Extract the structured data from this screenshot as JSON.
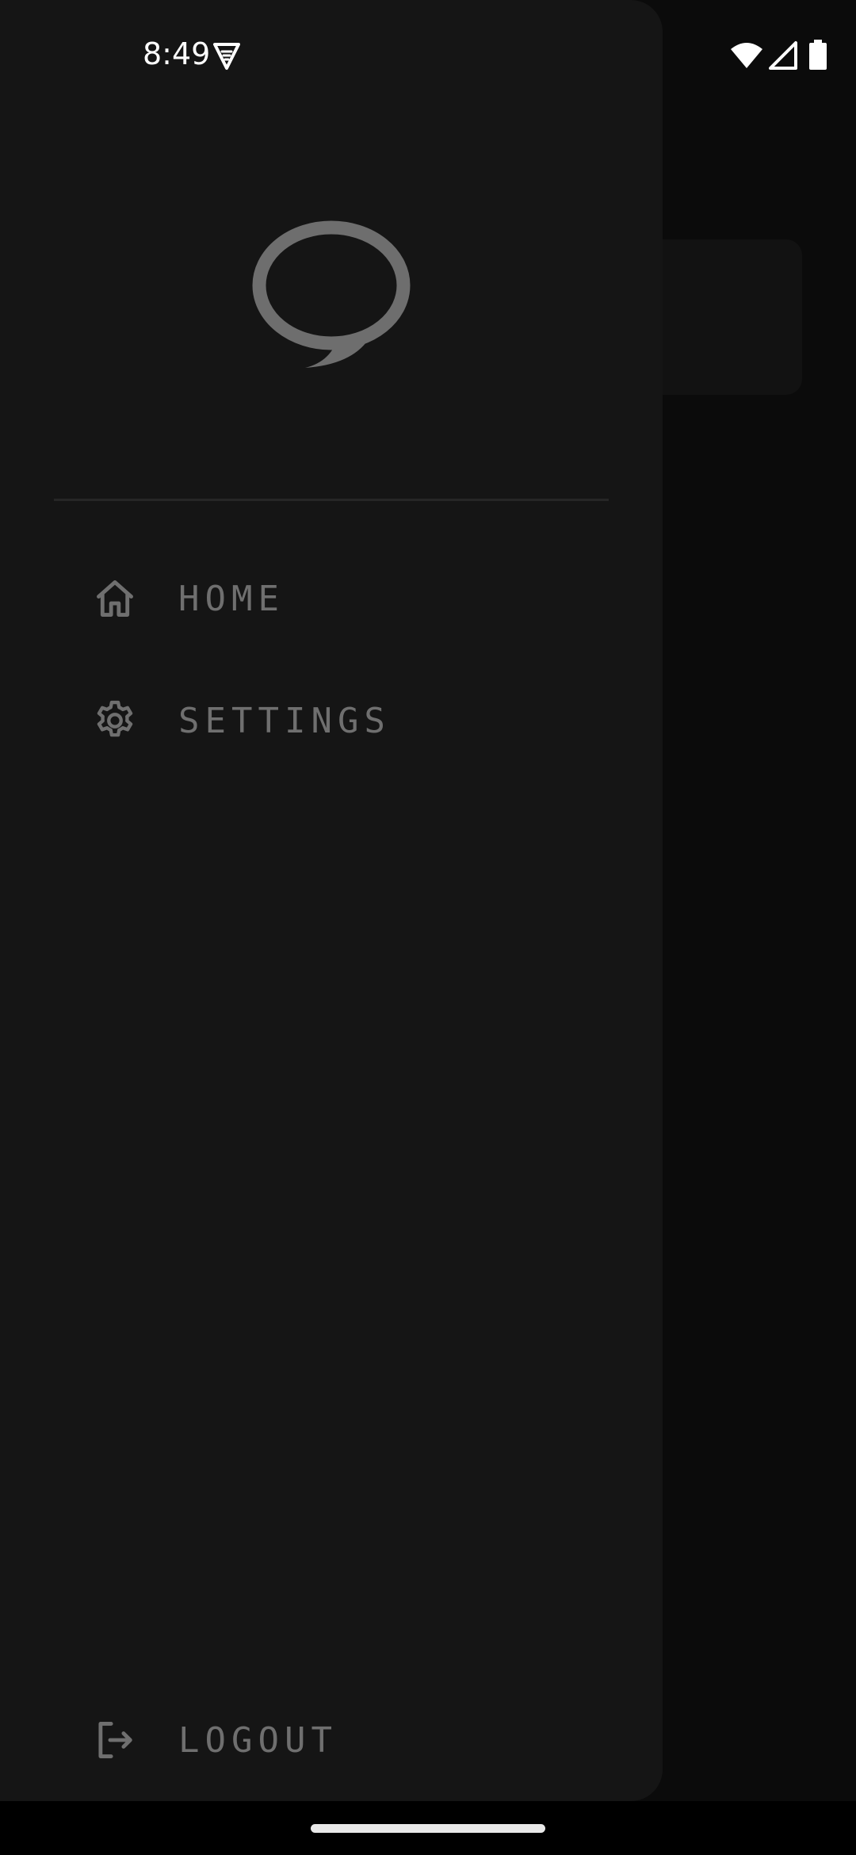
{
  "status_bar": {
    "time": "8:49",
    "vpn_icon": "vpn-key-icon",
    "wifi_icon": "wifi-icon",
    "signal_icon": "cell-signal-icon",
    "battery_icon": "battery-icon"
  },
  "drawer": {
    "logo_icon": "speech-bubble-logo-icon",
    "nav_items": [
      {
        "label": "HOME",
        "icon": "home-icon"
      },
      {
        "label": "SETTINGS",
        "icon": "gear-icon"
      }
    ],
    "logout": {
      "label": "LOGOUT",
      "icon": "logout-icon"
    }
  },
  "colors": {
    "drawer_background": "#151515",
    "screen_background": "#0b0b0b",
    "nav_text": "#6f6f6f",
    "icon": "#6f6f6f",
    "logo": "#6e6e6e"
  }
}
